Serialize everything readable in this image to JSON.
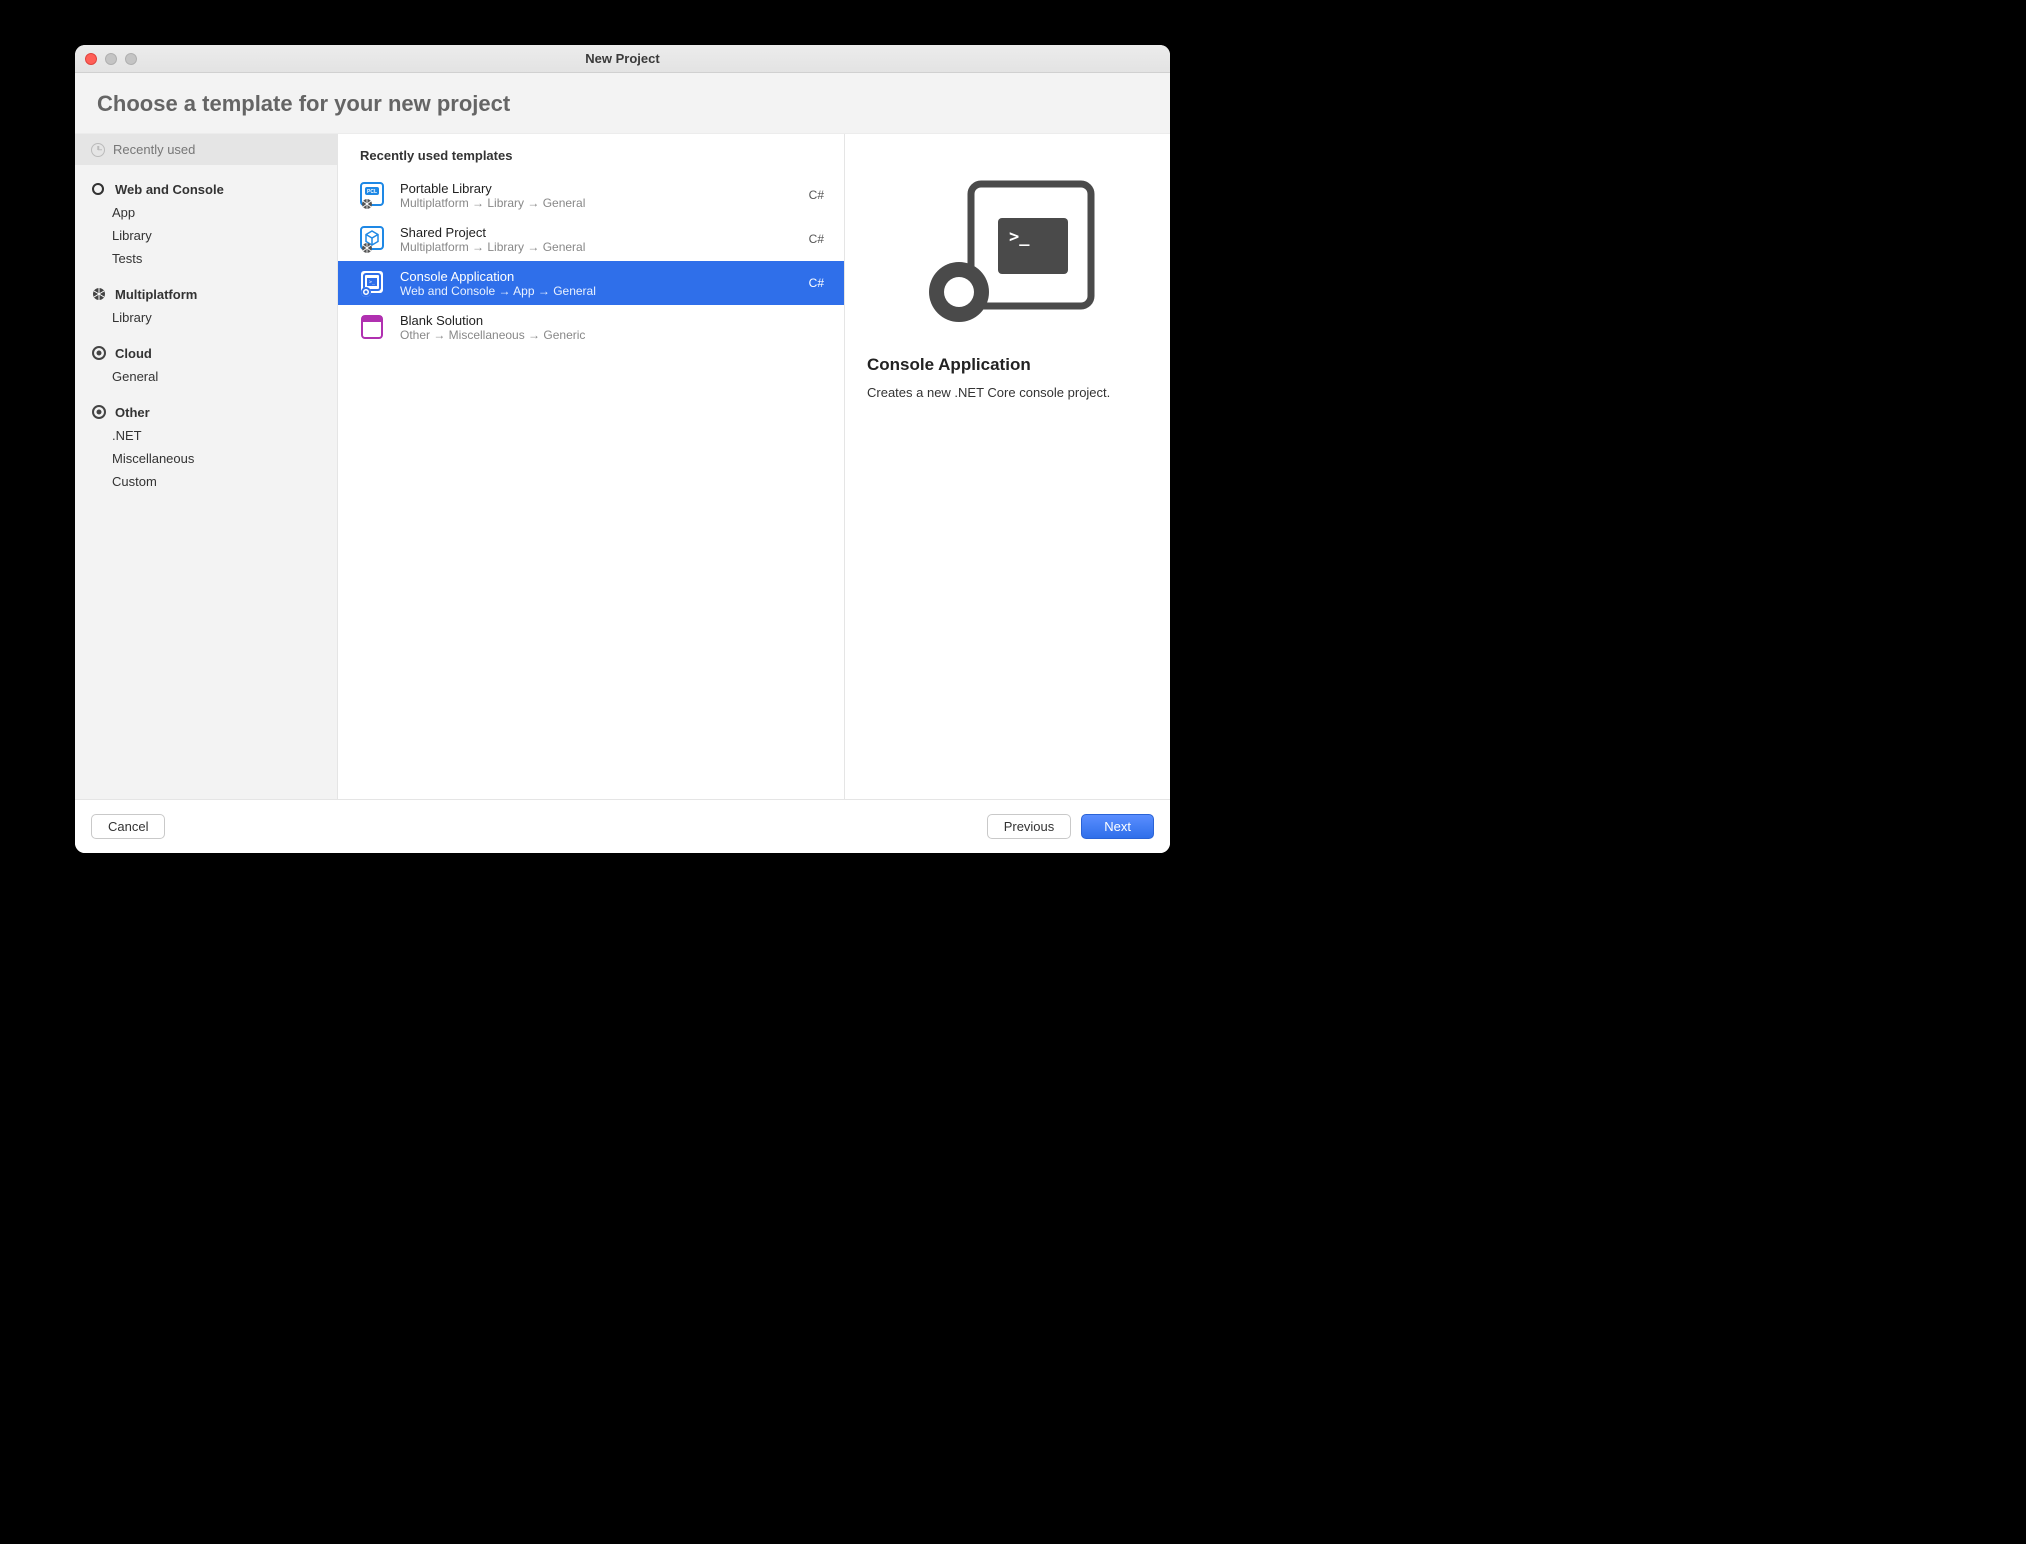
{
  "window": {
    "title": "New Project"
  },
  "header": {
    "title": "Choose a template for your new project"
  },
  "sidebar": {
    "recent_label": "Recently used",
    "sections": [
      {
        "label": "Web and Console",
        "icon": "web-console-icon",
        "items": [
          "App",
          "Library",
          "Tests"
        ]
      },
      {
        "label": "Multiplatform",
        "icon": "multiplatform-icon",
        "items": [
          "Library"
        ]
      },
      {
        "label": "Cloud",
        "icon": "cloud-icon",
        "items": [
          "General"
        ]
      },
      {
        "label": "Other",
        "icon": "other-icon",
        "items": [
          ".NET",
          "Miscellaneous",
          "Custom"
        ]
      }
    ]
  },
  "center": {
    "header": "Recently used templates",
    "templates": [
      {
        "title": "Portable Library",
        "path": "Multiplatform → Library → General",
        "lang": "C#",
        "icon": "pcl-icon",
        "selected": false
      },
      {
        "title": "Shared Project",
        "path": "Multiplatform → Library → General",
        "lang": "C#",
        "icon": "shared-project-icon",
        "selected": false
      },
      {
        "title": "Console Application",
        "path": "Web and Console → App → General",
        "lang": "C#",
        "icon": "console-app-icon",
        "selected": true
      },
      {
        "title": "Blank Solution",
        "path": "Other → Miscellaneous → Generic",
        "lang": "",
        "icon": "blank-solution-icon",
        "selected": false
      }
    ]
  },
  "detail": {
    "title": "Console Application",
    "description": "Creates a new .NET Core console project."
  },
  "footer": {
    "cancel": "Cancel",
    "previous": "Previous",
    "next": "Next"
  }
}
